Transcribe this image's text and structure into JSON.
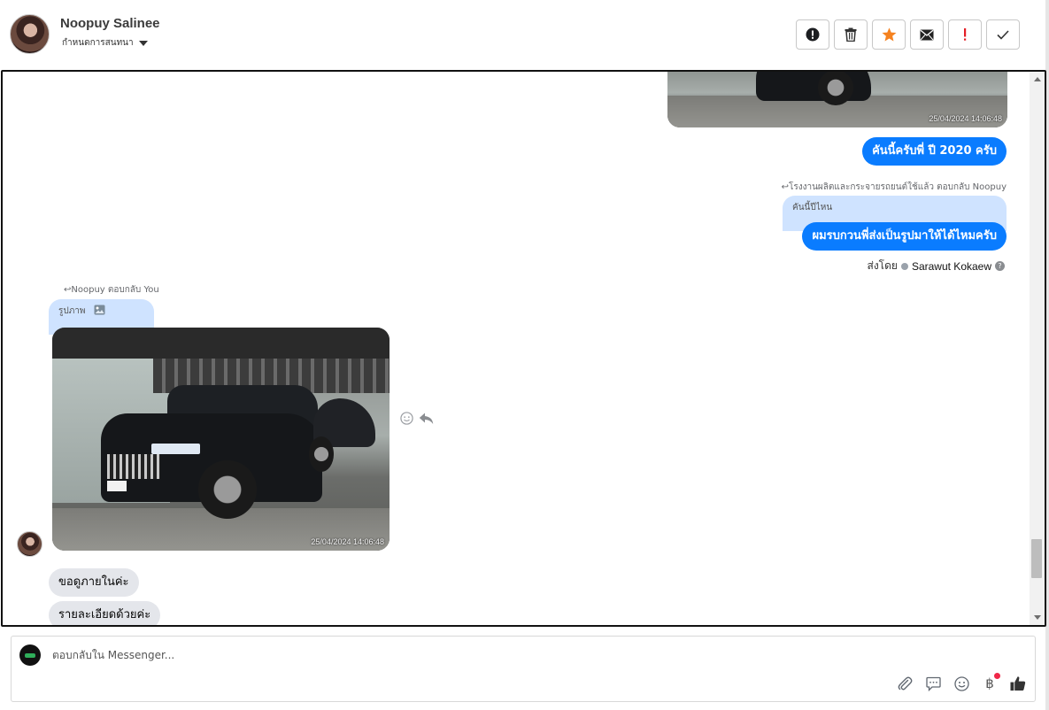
{
  "header": {
    "contact_name": "Noopuy Salinee",
    "assign_label": "กำหนดการสนทนา",
    "toolbar": [
      "alert-circle-icon",
      "trash-icon",
      "star-icon",
      "envelope-icon",
      "exclamation-icon",
      "check-icon"
    ]
  },
  "conversation": {
    "top_photo": {
      "timestamp": "25/04/2024 14:06:48"
    },
    "out_message_1": "คันนี้ครับพี่ ปี 2020 ครับ",
    "reply_meta_1": "โรงงานผลิตและกระจายรถยนต์ใช้แล้ว ตอบกลับ Noopuy",
    "quoted_text_1": "คันนี้ปีไหน",
    "out_message_2": "ผมรบกวนพี่ส่งเป็นรูปมาให้ได้ไหมครับ",
    "sent_by_label": "ส่งโดย",
    "sent_by_agent": "Sarawut Kokaew",
    "reply_meta_2": "Noopuy ตอบกลับ You",
    "quoted_text_2": "รูปภาพ",
    "in_photo": {
      "timestamp": "25/04/2024 14:06:48"
    },
    "in_message_1": "ขอดูภายในค่ะ",
    "in_message_2": "รายละเอียดด้วยค่ะ"
  },
  "composer": {
    "placeholder": "ตอบกลับใน Messenger...",
    "tools": [
      "paperclip-icon",
      "comment-icon",
      "smile-icon",
      "baht-icon",
      "thumbs-up-icon"
    ],
    "baht_symbol": "฿"
  },
  "colors": {
    "primary_blue": "#0a7cff",
    "quote_blue": "#cfe3ff",
    "incoming_gray": "#e4e6eb",
    "star_orange": "#f5821f",
    "alert_red": "#e41e26"
  }
}
